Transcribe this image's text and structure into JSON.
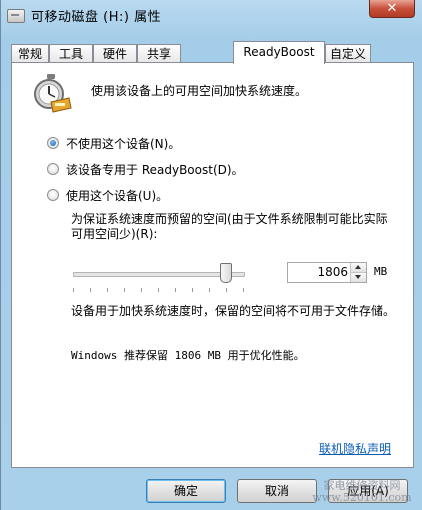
{
  "window": {
    "title": "可移动磁盘 (H:) 属性",
    "close_glyph": "✕"
  },
  "tabs": [
    {
      "label": "常规"
    },
    {
      "label": "工具"
    },
    {
      "label": "硬件"
    },
    {
      "label": "共享"
    },
    {
      "label": "ReadyBoost",
      "active": true
    },
    {
      "label": "自定义"
    }
  ],
  "readyboost": {
    "icon": "readyboost-stopwatch-icon",
    "heading": "使用该设备上的可用空间加快系统速度。",
    "options": [
      {
        "label": "不使用这个设备(N)。",
        "checked": true
      },
      {
        "label": "该设备专用于 ReadyBoost(D)。",
        "checked": false
      },
      {
        "label": "使用这个设备(U)。",
        "checked": false
      }
    ],
    "reserve_label": "为保证系统速度而预留的空间(由于文件系统限制可能比实际可用空间少)(R):",
    "slider_fraction": 0.9,
    "reserve_value": "1806",
    "unit": "MB",
    "note": "设备用于加快系统速度时，保留的空间将不可用于文件存储。",
    "recommend": "Windows 推荐保留 1806 MB 用于优化性能。",
    "privacy_link": "联机隐私声明"
  },
  "buttons": {
    "ok": "确定",
    "cancel": "取消",
    "apply": "应用(A)"
  },
  "watermark": {
    "line1": "家电维修资料网",
    "line2": "www.520101.com"
  }
}
